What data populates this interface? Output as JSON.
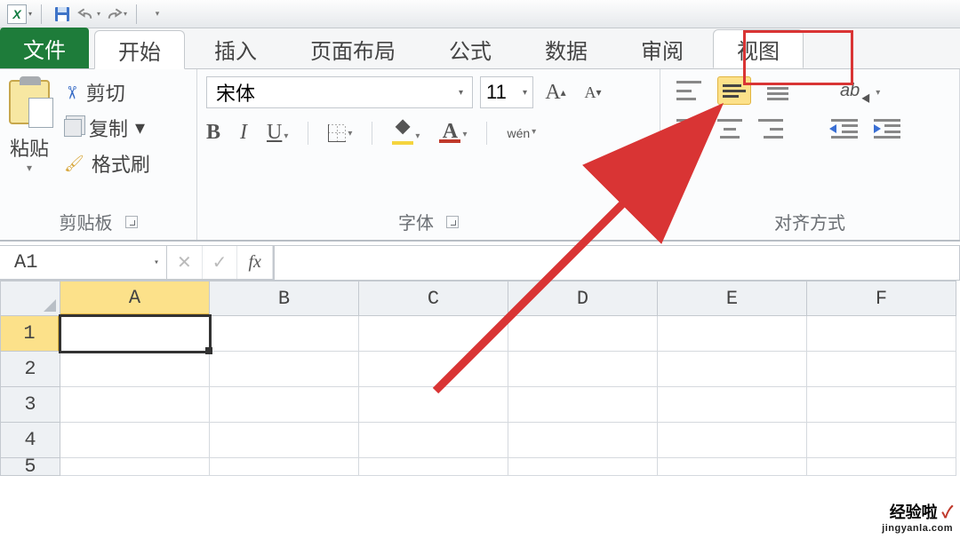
{
  "qat": {
    "logo_letter": "X"
  },
  "tabs": {
    "file": "文件",
    "home": "开始",
    "insert": "插入",
    "page_layout": "页面布局",
    "formulas": "公式",
    "data": "数据",
    "review": "审阅",
    "view": "视图"
  },
  "clipboard": {
    "paste": "粘贴",
    "cut": "剪切",
    "copy": "复制",
    "format_painter": "格式刷",
    "group_label": "剪贴板"
  },
  "font": {
    "name": "宋体",
    "size": "11",
    "bold": "B",
    "italic": "I",
    "underline": "U",
    "ruby": "wén",
    "font_color_letter": "A",
    "grow_A": "A",
    "shrink_A": "A",
    "group_label": "字体"
  },
  "alignment": {
    "orient": "ab",
    "dd_arrow": "▾",
    "group_label": "对齐方式"
  },
  "formula_bar": {
    "name_box": "A1",
    "cancel": "✕",
    "enter": "✓",
    "fx": "fx",
    "value": ""
  },
  "grid": {
    "columns": [
      "A",
      "B",
      "C",
      "D",
      "E",
      "F"
    ],
    "rows": [
      "1",
      "2",
      "3",
      "4",
      "5"
    ],
    "selected_cell": "A1"
  },
  "watermark": {
    "text": "经验啦",
    "check": "✓",
    "url": "jingyanla.com"
  }
}
